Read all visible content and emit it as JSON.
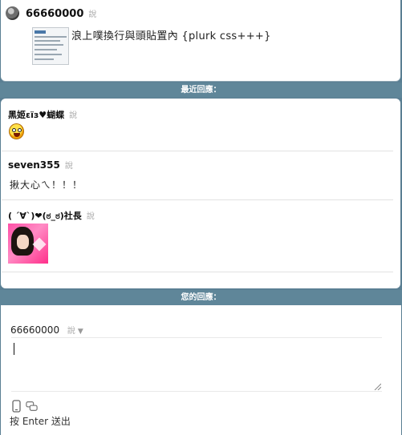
{
  "plurk": {
    "owner": "66660000",
    "says": "說",
    "content": "浪上噗換行與頭貼置內 {plurk css+++}"
  },
  "recent": {
    "header": "最近回應：",
    "responses": [
      {
        "name": "黑姬εïз♥蝴蝶",
        "says": "說",
        "content_type": "emoticon",
        "icon": "laughing-emoticon"
      },
      {
        "name": "seven355",
        "says": "說",
        "content": "揪大心ㄟ！！！"
      },
      {
        "name": "( ˊ∀ˋ)❤(ಠ_ಠ)社長",
        "says": "說",
        "content_type": "image",
        "icon": "anime-girl-photo"
      }
    ]
  },
  "reply": {
    "header": "您的回應：",
    "name": "66660000",
    "says": "說",
    "dropdown_icon": "triangle-down-icon",
    "textarea_value": "",
    "mode_icons": [
      "phone-icon",
      "chat-bubbles-icon"
    ],
    "hint": "按 Enter 送出"
  }
}
